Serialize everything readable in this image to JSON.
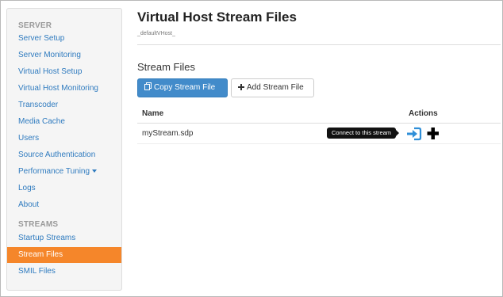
{
  "sidebar": {
    "server_header": "SERVER",
    "server_items": [
      {
        "label": "Server Setup"
      },
      {
        "label": "Server Monitoring"
      },
      {
        "label": "Virtual Host Setup"
      },
      {
        "label": "Virtual Host Monitoring"
      },
      {
        "label": "Transcoder"
      },
      {
        "label": "Media Cache"
      },
      {
        "label": "Users"
      },
      {
        "label": "Source Authentication"
      },
      {
        "label": "Performance Tuning"
      },
      {
        "label": "Logs"
      },
      {
        "label": "About"
      }
    ],
    "streams_header": "STREAMS",
    "streams_items": [
      {
        "label": "Startup Streams"
      },
      {
        "label": "Stream Files",
        "active": true
      },
      {
        "label": "SMIL Files"
      }
    ]
  },
  "page": {
    "title": "Virtual Host Stream Files",
    "subtitle": "_defaultVHost_"
  },
  "stream_files": {
    "section_title": "Stream Files",
    "copy_button": "Copy Stream File",
    "add_button": "Add Stream File",
    "columns": {
      "name": "Name",
      "actions": "Actions"
    },
    "rows": [
      {
        "name": "myStream.sdp"
      }
    ],
    "tooltip": "Connect to this stream"
  },
  "colors": {
    "accent": "#f5862a",
    "link": "#2f7bbf",
    "primary_button": "#428bca"
  },
  "icons": {
    "copy": "copy-icon",
    "plus": "plus-icon",
    "connect": "connect-icon",
    "add": "add-icon",
    "caret": "chevron-down-icon"
  }
}
